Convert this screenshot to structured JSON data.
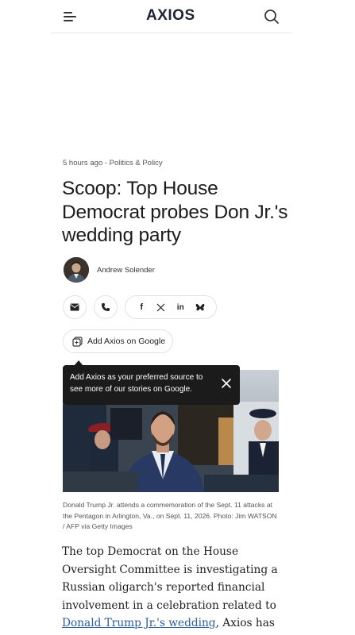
{
  "header": {
    "menu_icon": "hamburger-menu-icon",
    "logo": "AXIOS",
    "search_icon": "search-icon"
  },
  "article": {
    "meta": "5 hours ago - Politics & Policy",
    "headline": "Scoop: Top House Democrat probes Don Jr.'s wedding party",
    "author": "Andrew Solender",
    "share": {
      "icons": [
        "email-icon",
        "phone-icon",
        "facebook-icon",
        "x-icon",
        "linkedin-icon",
        "bluesky-icon"
      ],
      "facebook_glyph": "f",
      "linkedin_glyph": "in"
    },
    "google_button": "Add Axios on Google",
    "tooltip": {
      "text": "Add Axios as your preferred source to see more of our stories on Google."
    },
    "caption": "Donald Trump Jr. attends a commemoration of the Sept. 11 attacks at the Pentagon in Arlington, Va., on Sept. 11, 2026. Photo: Jim WATSON / AFP via Getty Images",
    "body_before": "The top Democrat on the House Oversight Committee is investigating a Russian oligarch's reported financial involvement in a celebration related to ",
    "body_link": "Donald Trump Jr.'s wedding",
    "body_after": ", Axios has learned."
  },
  "colors": {
    "link": "#2b5d9c",
    "tooltip_bg": "#1b1b1b",
    "logo": "#1c2331"
  }
}
